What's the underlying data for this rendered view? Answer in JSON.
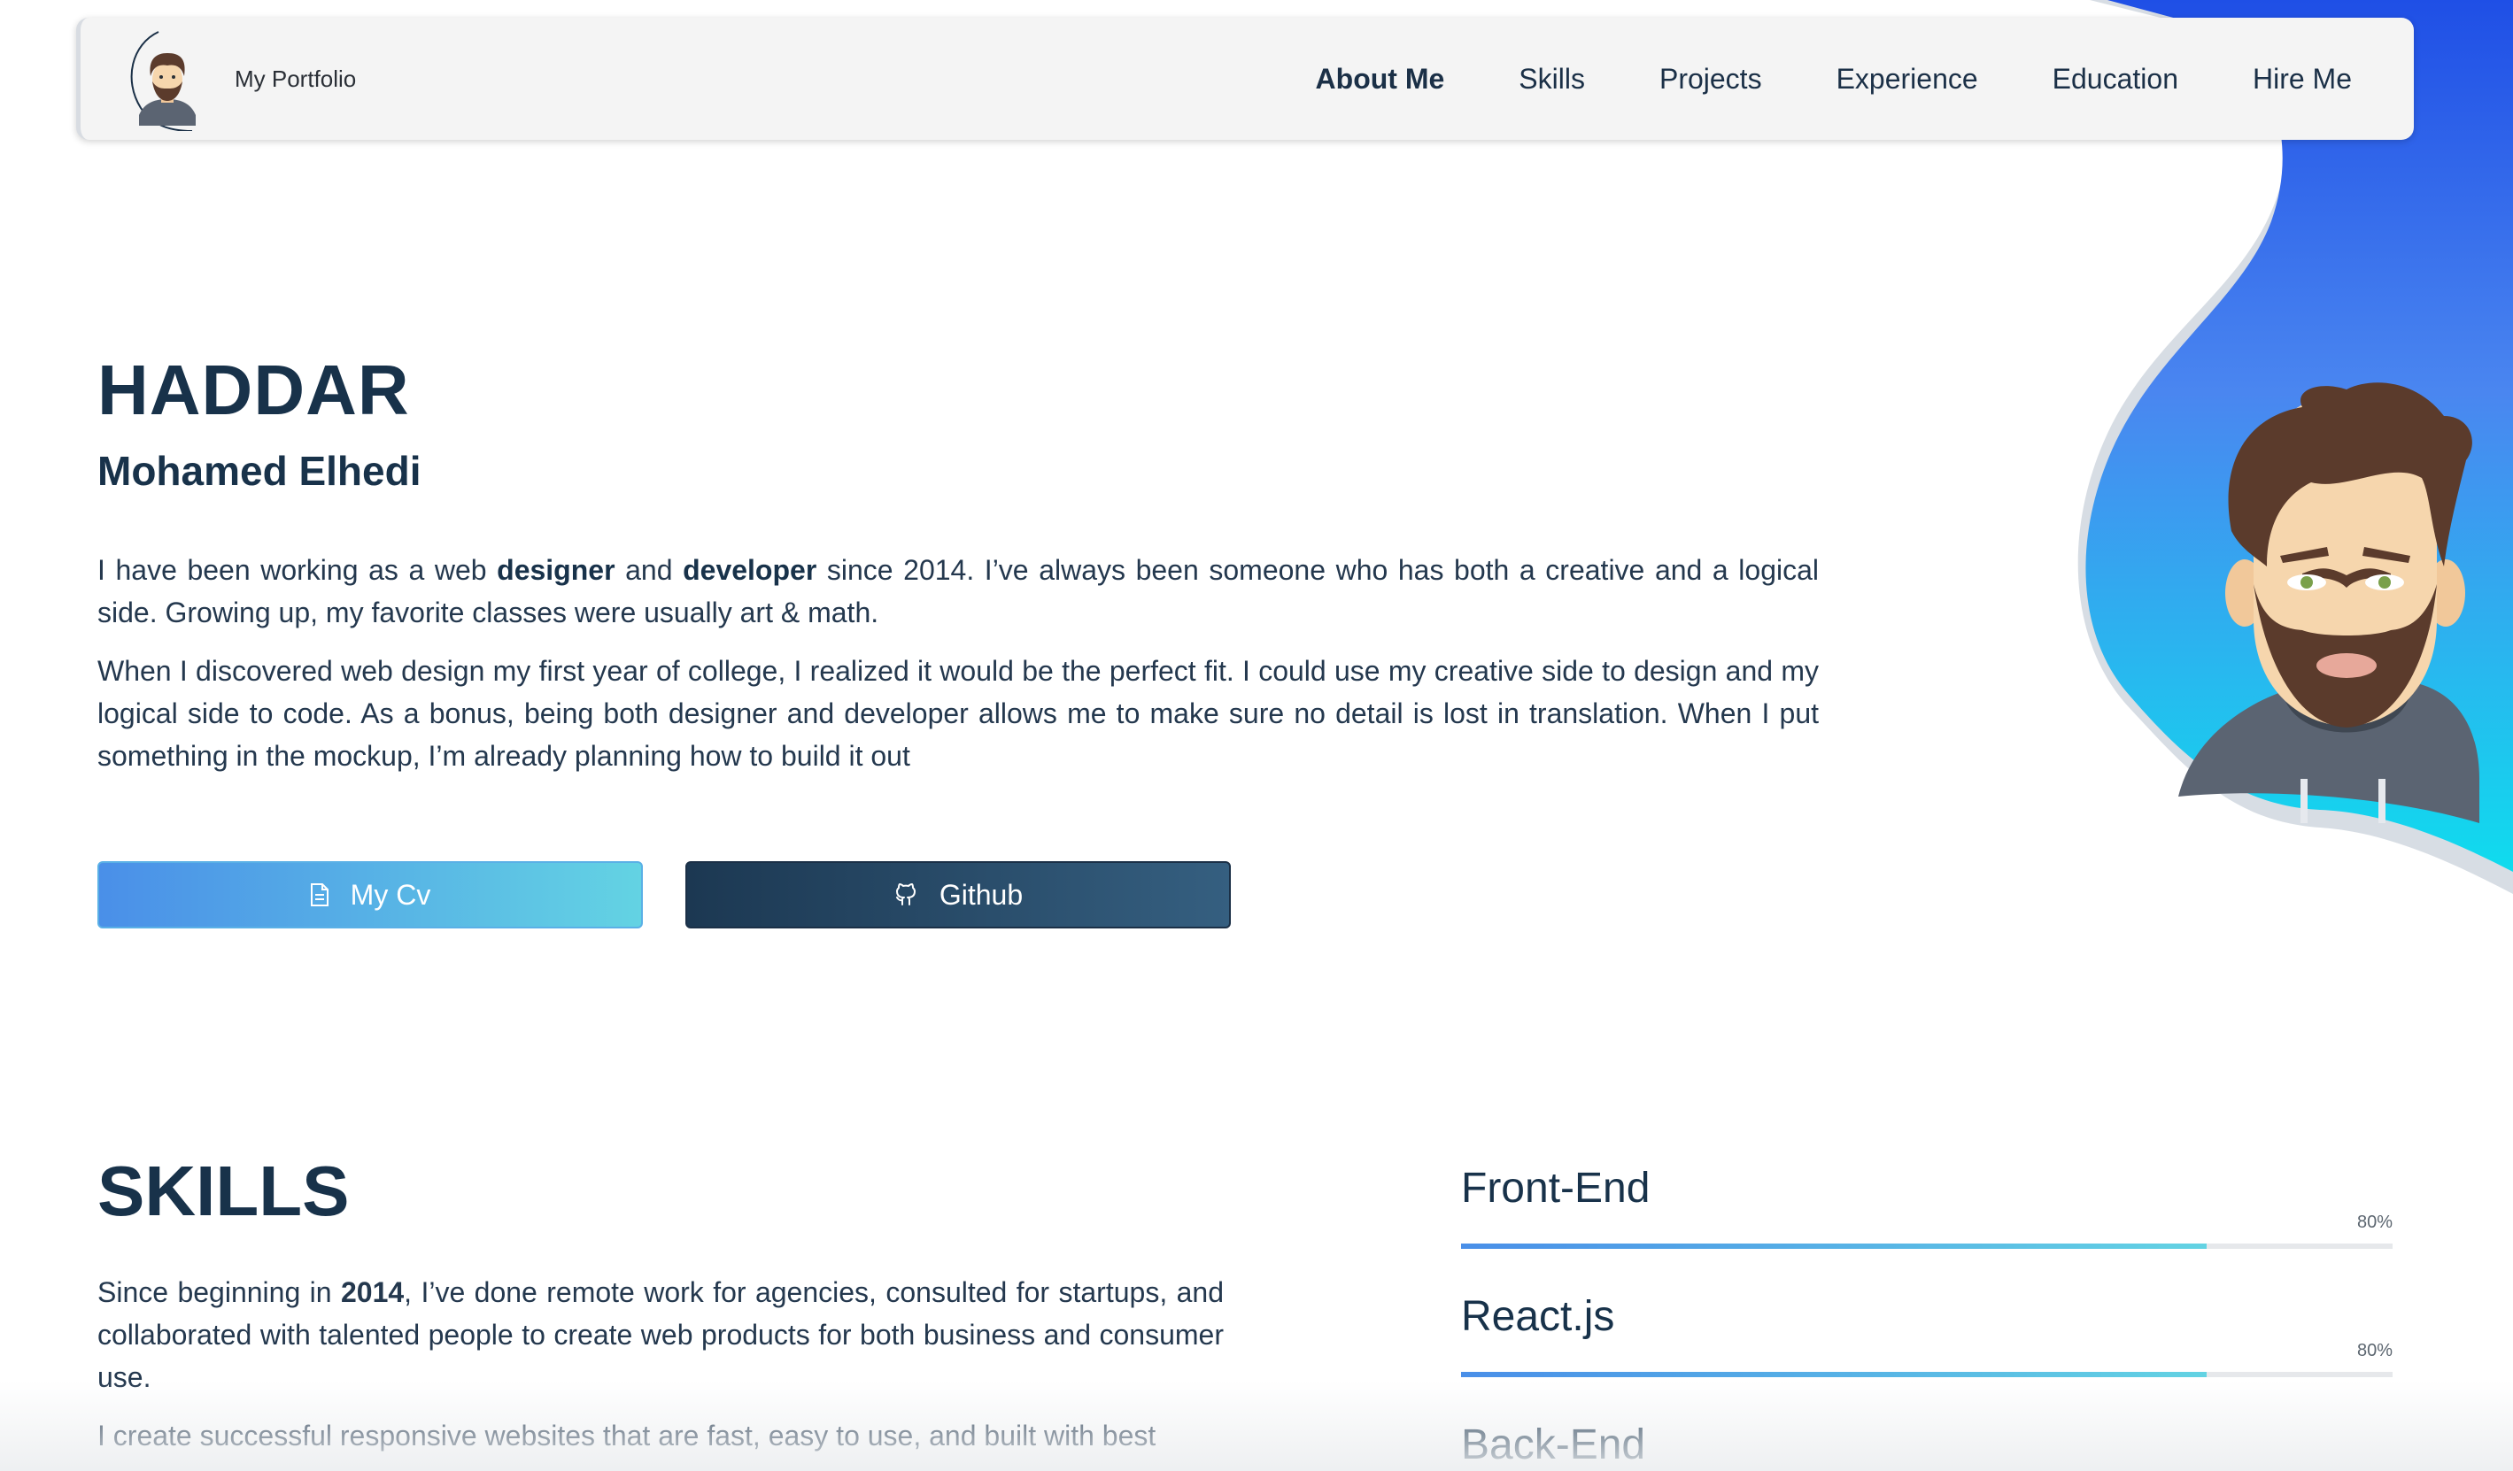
{
  "nav": {
    "brand": "My Portfolio",
    "links": [
      {
        "label": "About Me",
        "active": true
      },
      {
        "label": "Skills"
      },
      {
        "label": "Projects"
      },
      {
        "label": "Experience"
      },
      {
        "label": "Education"
      },
      {
        "label": "Hire Me"
      }
    ]
  },
  "hero": {
    "last_name": "HADDAR",
    "first_name": "Mohamed Elhedi",
    "p1": {
      "a": "I have been working as a web ",
      "b1": "designer",
      "c": " and ",
      "b2": "developer",
      "d": " since 2014. I’ve always been someone who has both a creative and a logical side. Growing up, my favorite classes were usually art & math."
    },
    "p2": "When I discovered web design my first year of college, I realized it would be the perfect fit. I could use my creative side to design and my logical side to code. As a bonus, being both designer and developer allows me to make sure no detail is lost in translation. When I put something in the mockup, I’m already planning how to build it out",
    "buttons": {
      "cv": "My Cv",
      "github": "Github"
    }
  },
  "skills": {
    "title": "SKILLS",
    "p1": {
      "a": "Since beginning in ",
      "b": "2014",
      "c": ", I’ve done remote work for agencies, consulted for startups, and collaborated with talented people to create web products for both business and consumer use."
    },
    "p2": "I create successful responsive websites that are fast, easy to use, and built with best",
    "items": [
      {
        "name": "Front-End",
        "percent_label": "80%",
        "level": 0.8
      },
      {
        "name": "React.js",
        "percent_label": "80%",
        "level": 0.8
      },
      {
        "name": "Back-End"
      }
    ]
  },
  "colors": {
    "navy": "#18324a",
    "blue": "#4a8fe8",
    "cyan": "#63d3e3",
    "blob_top": "#2a5ce8",
    "blob_bottom": "#12d6ee"
  },
  "icons": {
    "cv": "document-icon",
    "github": "github-icon"
  }
}
